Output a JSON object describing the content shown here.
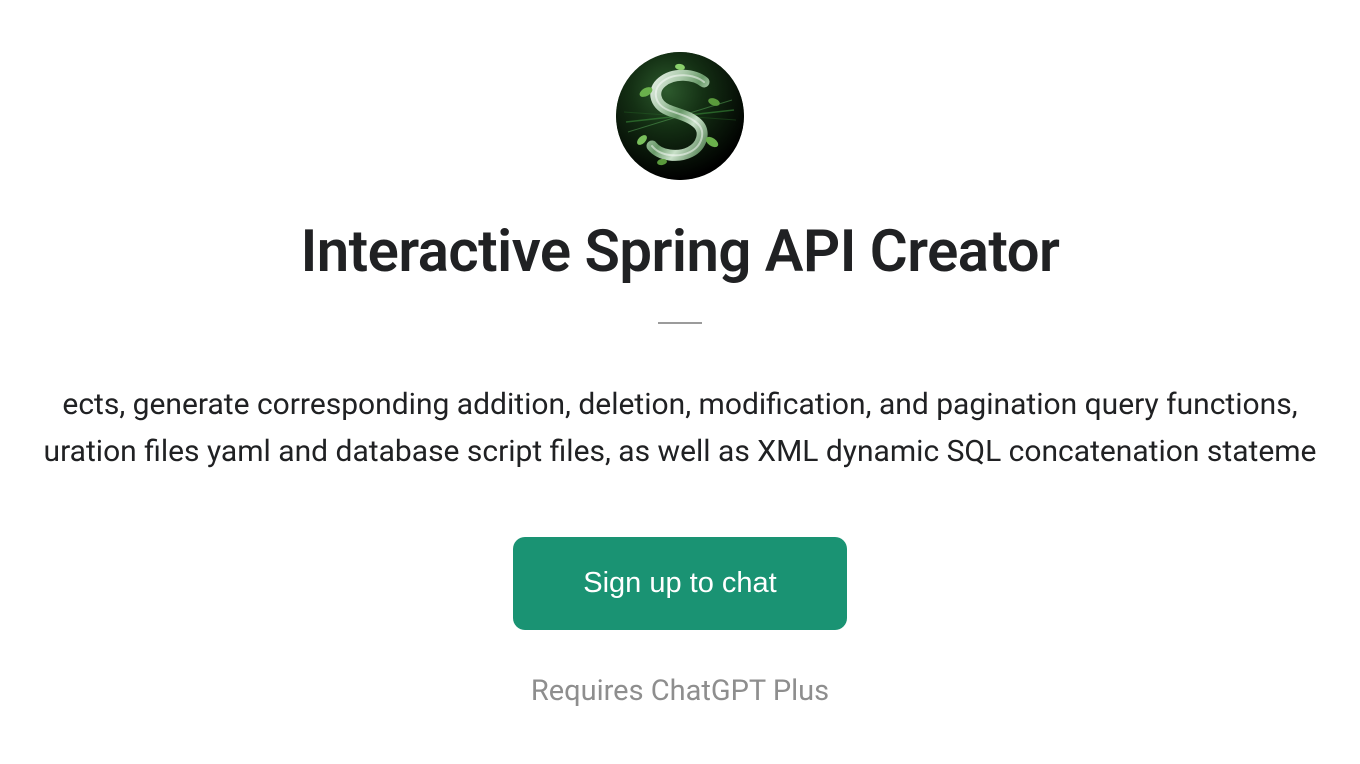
{
  "avatar": {
    "alt": "spring-leaf-s-logo"
  },
  "title": "Interactive Spring API Creator",
  "description_line1": "ects, generate corresponding addition, deletion, modification, and pagination query functions,",
  "description_line2": "uration files yaml and database script files, as well as XML dynamic SQL concatenation stateme",
  "cta": {
    "label": "Sign up to chat"
  },
  "footer": {
    "requires": "Requires ChatGPT Plus"
  },
  "colors": {
    "brand": "#1a9373",
    "text": "#202123",
    "muted": "#8e8e8e"
  }
}
